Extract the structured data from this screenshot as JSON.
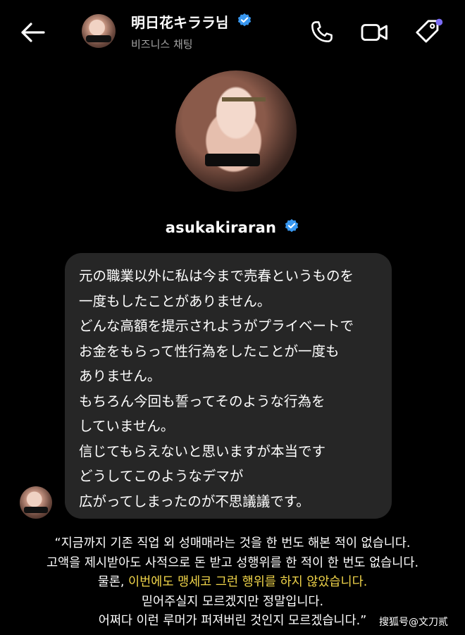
{
  "header": {
    "contact_name": "明日花キララ님",
    "subtitle": "비즈니스 채팅"
  },
  "profile": {
    "username": "asukakiraran"
  },
  "message": {
    "lines": [
      "元の職業以外に私は今まで売春というものを",
      "一度もしたことがありません。",
      "どんな高額を提示されようがプライベートで",
      "お金をもらって性行為をしたことが一度も",
      "ありません。",
      "もちろん今回も誓ってそのような行為を",
      "していません。",
      "信じてもらえないと思いますが本当です",
      "どうしてこのようなデマが",
      "広がってしまったのが不思議議です。"
    ]
  },
  "translation": {
    "line1": "“지금까지 기존 직업 외 성매매라는 것을 한 번도 해본 적이 없습니다.",
    "line2": "고액을 제시받아도 사적으로 돈 받고 성행위를 한 적이 한 번도 없습니다.",
    "line3_prefix": "물론, ",
    "line3_highlight": "이번에도 맹세코 그런 행위를 하지 않았습니다.",
    "line4": "믿어주실지 모르겠지만 정말입니다.",
    "line5": "어쩌다 이런 루머가 퍼져버린 것인지 모르겠습니다.”"
  },
  "watermark": "搜狐号@文刀贰",
  "colors": {
    "background": "#000000",
    "bubble": "#262626",
    "verified": "#3897f0",
    "highlight": "#f1d54a",
    "badge_dot": "#7b6cf6"
  }
}
